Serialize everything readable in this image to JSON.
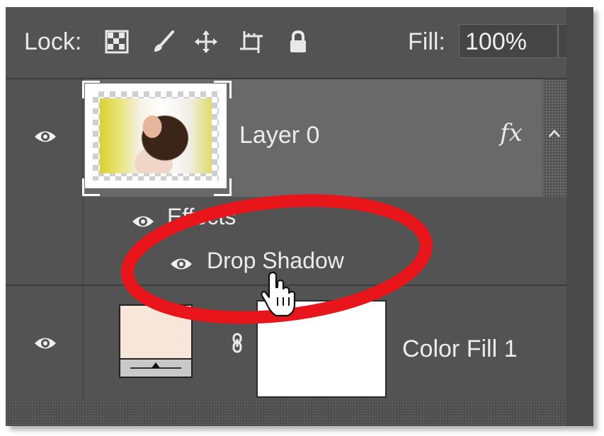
{
  "lock_bar": {
    "lock_label": "Lock:",
    "lock_icons": [
      "lock-transparent-pixels-icon",
      "lock-image-pixels-icon",
      "lock-position-icon",
      "lock-artboard-icon",
      "lock-all-icon"
    ],
    "fill_label": "Fill:",
    "fill_value": "100%",
    "fill_dropdown_icon": "chevron-down-icon"
  },
  "layers": [
    {
      "name": "Layer 0",
      "selected": true,
      "visibility_icon": "eye-icon",
      "fx_label": "fx",
      "collapse_icon": "chevron-up-icon",
      "effects_label": "Effects",
      "effects": [
        {
          "name": "Drop Shadow",
          "visibility_icon": "eye-icon"
        }
      ]
    },
    {
      "name": "Color Fill 1",
      "selected": false,
      "visibility_icon": "eye-icon",
      "fill_color": "#f9e6db",
      "link_icon": "chain-link-icon"
    }
  ],
  "annotation": {
    "shape": "ellipse",
    "color": "#e8151b",
    "cursor": "hand-pointer-icon"
  },
  "colors": {
    "panel_bg": "#535353",
    "selected_row_bg": "#696969",
    "text": "#ececec"
  }
}
